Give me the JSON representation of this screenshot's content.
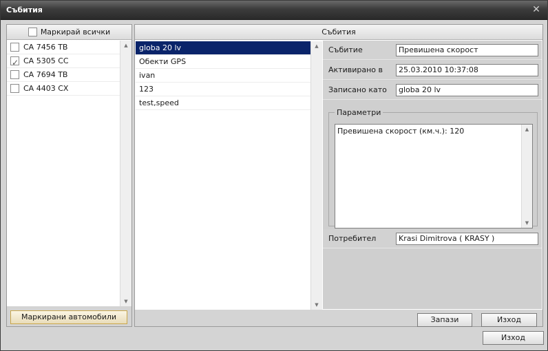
{
  "window": {
    "title": "Събития"
  },
  "vehicles": {
    "select_all_label": "Маркирай всички",
    "items": [
      {
        "label": "CA 7456 TB",
        "checked": false
      },
      {
        "label": "CA 5305 CC",
        "checked": true
      },
      {
        "label": "CA 7694 TB",
        "checked": false
      },
      {
        "label": "CA 4403 CX",
        "checked": false
      }
    ],
    "marked_button": "Маркирани автомобили"
  },
  "events": {
    "header": "Събития",
    "items": [
      {
        "label": "globa 20 lv",
        "selected": true
      },
      {
        "label": "Обекти GPS",
        "selected": false
      },
      {
        "label": "ivan",
        "selected": false
      },
      {
        "label": "123",
        "selected": false
      },
      {
        "label": "test,speed",
        "selected": false
      }
    ]
  },
  "details": {
    "event_label": "Събитие",
    "event_value": "Превишена скорост",
    "activated_label": "Активирано в",
    "activated_value": "25.03.2010 10:37:08",
    "recorded_label": "Записано като",
    "recorded_value": "globa 20 lv",
    "params_legend": "Параметри",
    "params_text": "Превишена скорост (км.ч.): 120",
    "user_label": "Потребител",
    "user_value": "Krasi Dimitrova ( KRASY )"
  },
  "buttons": {
    "save": "Запази",
    "exit_inner": "Изход",
    "exit_outer": "Изход"
  }
}
